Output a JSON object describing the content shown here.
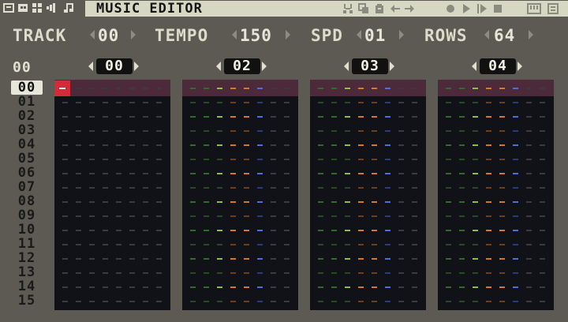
{
  "title": "MUSIC EDITOR",
  "header": {
    "track_label": "TRACK",
    "track_value": "00",
    "tempo_label": "TEMPO",
    "tempo_value": "150",
    "spd_label": "SPD",
    "spd_value": "01",
    "rows_label": "ROWS",
    "rows_value": "64"
  },
  "position_label": "00",
  "patterns": [
    "00",
    "02",
    "03",
    "04"
  ],
  "rows": [
    "00",
    "01",
    "02",
    "03",
    "04",
    "05",
    "06",
    "07",
    "08",
    "09",
    "10",
    "11",
    "12",
    "13",
    "14",
    "15"
  ],
  "current_row": "00",
  "toolbar_left_icons": [
    "code-icon",
    "sprite-icon",
    "map-icon",
    "sfx-icon",
    "music-icon"
  ],
  "toolbar_right_icons": [
    "cut-icon",
    "copy-icon",
    "paste-icon",
    "undo-icon",
    "redo-icon",
    "record-icon",
    "play-icon",
    "play-pattern-icon",
    "stop-icon",
    "keyboard-icon",
    "list-icon"
  ],
  "colors": {
    "background": "#5c5a52",
    "titlebar": "#d6d8c4",
    "channel_bg": "#111118",
    "row_highlight": "#4d2a3a",
    "cursor": "#d12c38",
    "note_green_dark": "#2f6b2a",
    "note_green_light": "#8fc03a",
    "note_orange": "#d07a2a",
    "note_blue": "#4f6fd8",
    "empty_dash": "#3a3a44"
  }
}
